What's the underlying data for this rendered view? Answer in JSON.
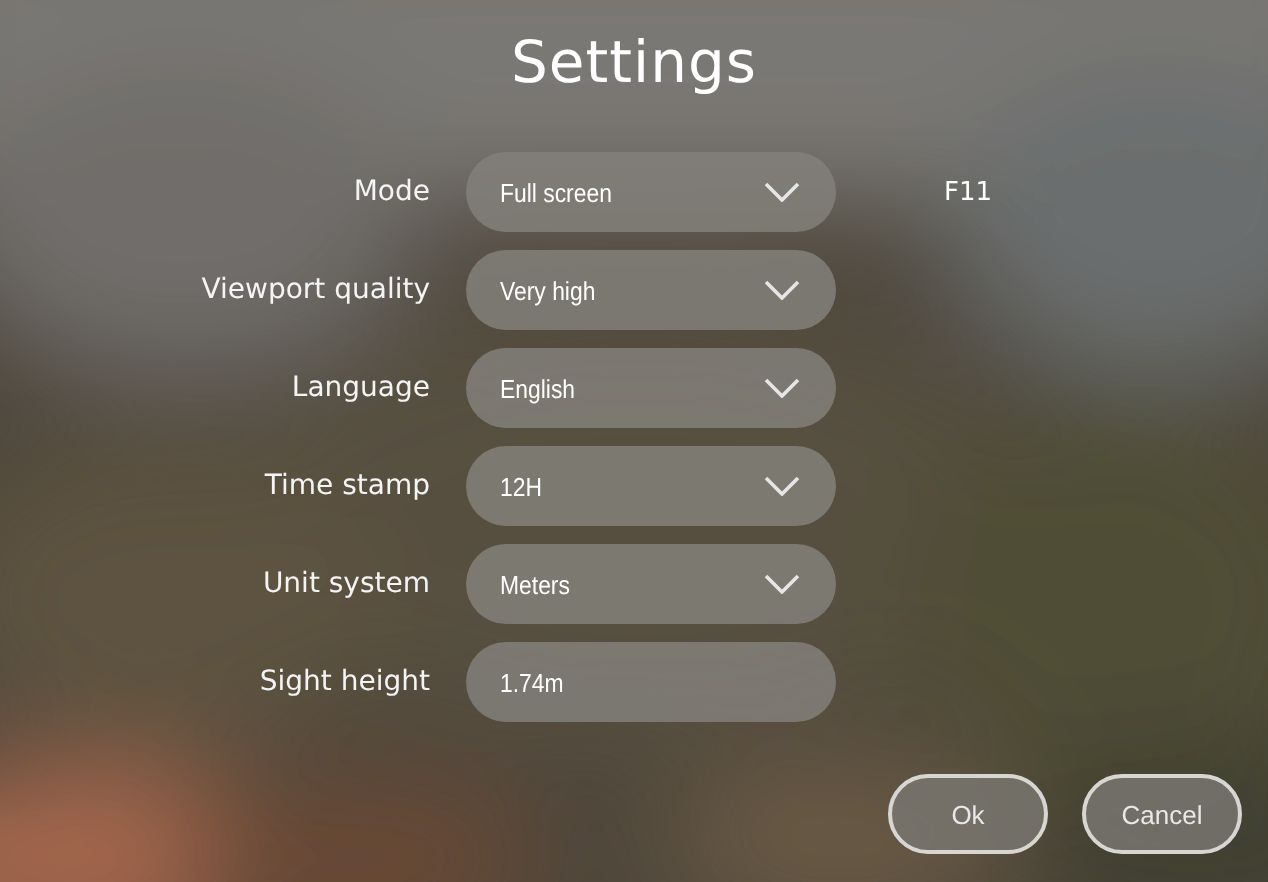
{
  "title": "Settings",
  "settings": [
    {
      "label": "Mode",
      "kind": "dropdown",
      "value": "Full screen",
      "shortcut": "F11"
    },
    {
      "label": "Viewport quality",
      "kind": "dropdown",
      "value": "Very high"
    },
    {
      "label": "Language",
      "kind": "dropdown",
      "value": "English"
    },
    {
      "label": "Time stamp",
      "kind": "dropdown",
      "value": "12H"
    },
    {
      "label": "Unit system",
      "kind": "dropdown",
      "value": "Meters"
    },
    {
      "label": "Sight height",
      "kind": "input",
      "value": "1.74m"
    }
  ],
  "buttons": [
    "Ok",
    "Cancel"
  ]
}
